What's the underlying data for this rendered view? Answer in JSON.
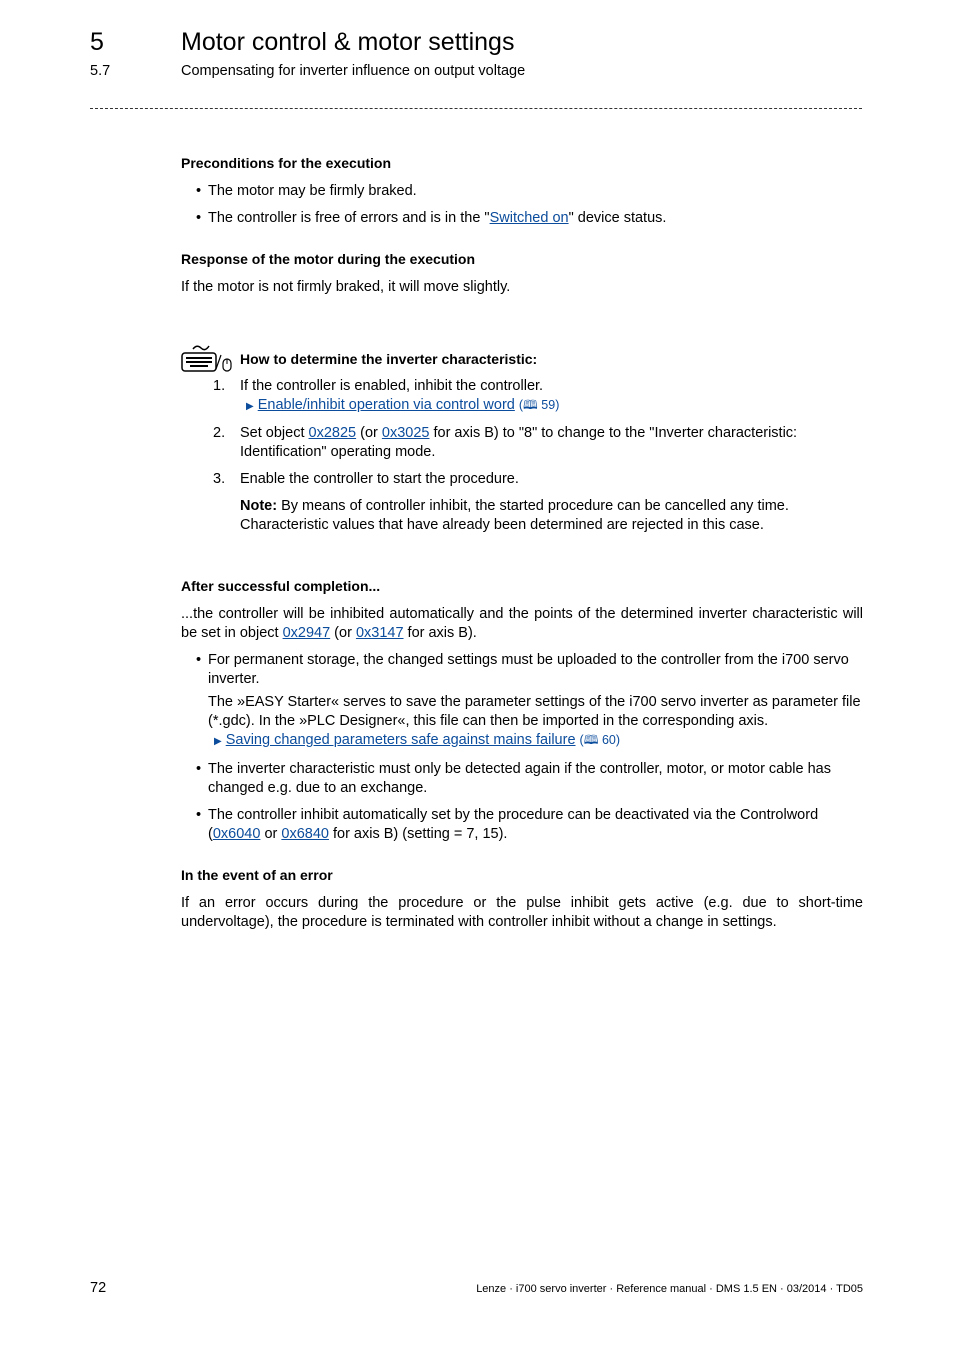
{
  "header": {
    "chapter_number": "5",
    "chapter_title": "Motor control & motor settings",
    "section_number": "5.7",
    "section_title": "Compensating for inverter influence on output voltage"
  },
  "preconditions": {
    "heading": "Preconditions for the execution",
    "bullets": [
      "The motor may be firmly braked.",
      "The controller is free of errors and is in the \"",
      "Switched on",
      "\" device status."
    ]
  },
  "response": {
    "heading": "Response of the motor during the execution",
    "text": "If the motor is not firmly braked, it will move slightly."
  },
  "howto": {
    "icon": "keyboard-mouse-icon",
    "heading": "How to determine the inverter characteristic:",
    "step1_num": "1.",
    "step1_text": "If the controller is enabled, inhibit the controller.",
    "step1_link": "Enable/inhibit operation via control word",
    "step1_ref": "59",
    "step2_num": "2.",
    "step2_a": "Set object ",
    "step2_link1": "0x2825",
    "step2_b": " (or ",
    "step2_link2": "0x3025",
    "step2_c": " for axis B) to \"8\" to change to the \"Inverter characteristic: Identification\" operating mode.",
    "step3_num": "3.",
    "step3_text": "Enable the controller to start the procedure.",
    "note_label": "Note:",
    "note_text": " By means of controller inhibit, the started procedure can be cancelled any time. Characteristic values that have already been determined are rejected in this case."
  },
  "after": {
    "heading": "After successful completion...",
    "p1_a": "...the controller will be inhibited automatically and the points of the determined inverter characteristic will be set in object ",
    "p1_link1": "0x2947",
    "p1_b": " (or ",
    "p1_link2": "0x3147",
    "p1_c": " for axis B).",
    "b1_text": "For permanent storage, the changed settings must be uploaded to the controller from the i700 servo inverter.",
    "b1_sub": "The »EASY Starter« serves to save the parameter settings of the i700 servo inverter as parameter file (*.gdc). In the »PLC Designer«, this file can then be imported in the corresponding axis.",
    "b1_link": "Saving changed parameters safe against mains failure",
    "b1_ref": "60",
    "b2_text": "The inverter characteristic must only be detected again if the controller, motor, or motor cable has changed e.g. due to an exchange.",
    "b3_a": "The controller inhibit automatically set by the procedure can be deactivated via the Controlword (",
    "b3_link1": "0x6040",
    "b3_b": " or ",
    "b3_link2": "0x6840",
    "b3_c": " for axis B) (setting = 7, 15)."
  },
  "error": {
    "heading": "In the event of an error",
    "text": "If an error occurs during the procedure or the pulse inhibit gets active (e.g. due to short-time undervoltage), the procedure is terminated with controller inhibit without a change in settings."
  },
  "footer": {
    "page_number": "72",
    "info": "Lenze · i700 servo inverter · Reference manual · DMS 1.5 EN · 03/2014 · TD05"
  }
}
